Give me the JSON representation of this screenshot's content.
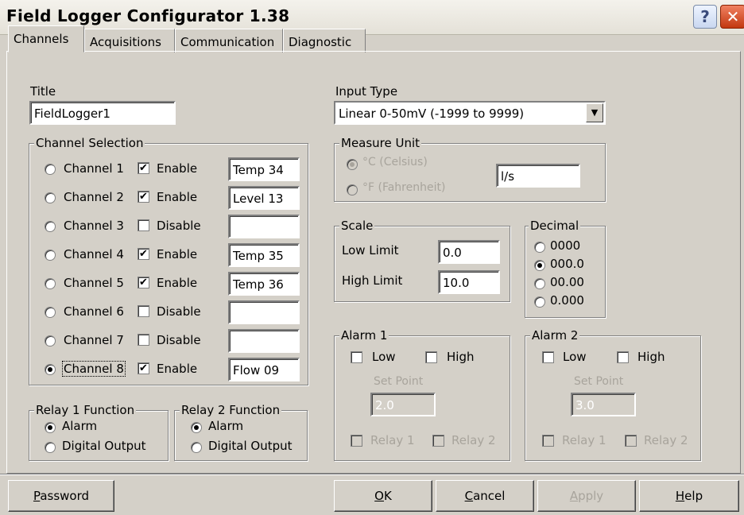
{
  "window": {
    "title": "Field Logger Configurator 1.38",
    "help_glyph": "?",
    "close_glyph": "✕"
  },
  "tabs": [
    {
      "label": "Channels",
      "active": true
    },
    {
      "label": "Acquisitions",
      "active": false
    },
    {
      "label": "Communication",
      "active": false
    },
    {
      "label": "Diagnostic",
      "active": false
    }
  ],
  "title_field": {
    "label": "Title",
    "value": "FieldLogger1"
  },
  "channel_selection": {
    "label": "Channel Selection",
    "channels": [
      {
        "label": "Channel 1",
        "selected": false,
        "checked": true,
        "state": "Enable",
        "name": "Temp 34"
      },
      {
        "label": "Channel 2",
        "selected": false,
        "checked": true,
        "state": "Enable",
        "name": "Level 13"
      },
      {
        "label": "Channel 3",
        "selected": false,
        "checked": false,
        "state": "Disable",
        "name": ""
      },
      {
        "label": "Channel 4",
        "selected": false,
        "checked": true,
        "state": "Enable",
        "name": "Temp 35"
      },
      {
        "label": "Channel 5",
        "selected": false,
        "checked": true,
        "state": "Enable",
        "name": "Temp 36"
      },
      {
        "label": "Channel 6",
        "selected": false,
        "checked": false,
        "state": "Disable",
        "name": ""
      },
      {
        "label": "Channel 7",
        "selected": false,
        "checked": false,
        "state": "Disable",
        "name": ""
      },
      {
        "label": "Channel 8",
        "selected": true,
        "checked": true,
        "state": "Enable",
        "name": "Flow 09"
      }
    ]
  },
  "relay1": {
    "label": "Relay 1 Function",
    "options": [
      "Alarm",
      "Digital Output"
    ],
    "selected": "Alarm"
  },
  "relay2": {
    "label": "Relay 2 Function",
    "options": [
      "Alarm",
      "Digital Output"
    ],
    "selected": "Alarm"
  },
  "input_type": {
    "label": "Input Type",
    "value": "Linear 0-50mV   (-1999 to 9999)"
  },
  "measure_unit": {
    "label": "Measure Unit",
    "celsius": "°C (Celsius)",
    "fahrenheit": "°F (Fahrenheit)",
    "custom_value": "l/s"
  },
  "scale": {
    "label": "Scale",
    "low_label": "Low Limit",
    "low_value": "0.0",
    "high_label": "High Limit",
    "high_value": "10.0"
  },
  "decimal": {
    "label": "Decimal",
    "options": [
      "0000",
      "000.0",
      "00.00",
      "0.000"
    ],
    "selected": "000.0"
  },
  "alarm1": {
    "label": "Alarm 1",
    "low": "Low",
    "high": "High",
    "set_point_label": "Set Point",
    "set_point": "2.0",
    "relay1": "Relay 1",
    "relay2": "Relay 2"
  },
  "alarm2": {
    "label": "Alarm 2",
    "low": "Low",
    "high": "High",
    "set_point_label": "Set Point",
    "set_point": "3.0",
    "relay1": "Relay 1",
    "relay2": "Relay 2"
  },
  "buttons": {
    "password": {
      "first": "P",
      "rest": "assword"
    },
    "ok": {
      "first": "O",
      "rest": "K"
    },
    "cancel": {
      "first": "C",
      "rest": "ancel"
    },
    "apply": {
      "first": "A",
      "rest": "pply"
    },
    "help": {
      "first": "H",
      "rest": "elp"
    }
  }
}
